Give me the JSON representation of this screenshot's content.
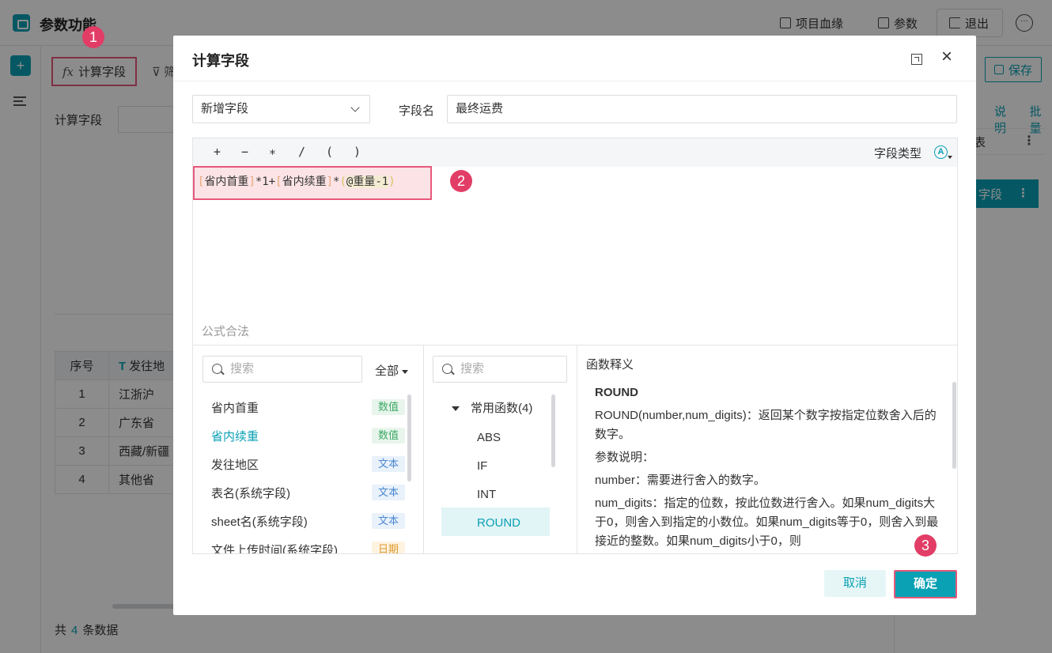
{
  "app": {
    "title": "参数功能",
    "lineage_label": "项目血缘",
    "params_label": "参数",
    "exit_label": "退出"
  },
  "toolbar": {
    "calc_field_label": "计算字段",
    "filter_label": "筛"
  },
  "main": {
    "calc_field_label": "计算字段",
    "table": {
      "headers": [
        "序号",
        "发往地"
      ],
      "rows": [
        [
          "1",
          "江浙沪"
        ],
        [
          "2",
          "广东省"
        ],
        [
          "3",
          "西藏/新疆"
        ],
        [
          "4",
          "其他省"
        ]
      ]
    },
    "footer": {
      "prefix": "共",
      "count": "4",
      "suffix": "条数据"
    }
  },
  "right_panel": {
    "save_label": "保存",
    "explain_link": "说明",
    "batch_link": "批量",
    "row_label": "表",
    "field_label": "字段"
  },
  "badges": [
    "1",
    "2",
    "3"
  ],
  "dialog": {
    "title": "计算字段",
    "mode_select": "新增字段",
    "field_name_label": "字段名",
    "field_name_value": "最终运费",
    "operators": [
      "+",
      "−",
      "∗",
      "/",
      "(",
      ")"
    ],
    "field_type_label": "字段类型",
    "field_type_icon": "A",
    "formula": {
      "part1": "省内首重",
      "op1": "*1+",
      "part2": "省内续重",
      "op2": "*",
      "part3": "@重量-1"
    },
    "hint": "公式合法",
    "fields_pane": {
      "search_placeholder": "搜索",
      "filter_label": "全部",
      "items": [
        {
          "label": "省内首重",
          "type": "数值",
          "kind": "num",
          "active": false
        },
        {
          "label": "省内续重",
          "type": "数值",
          "kind": "num",
          "active": true
        },
        {
          "label": "发往地区",
          "type": "文本",
          "kind": "txt",
          "active": false
        },
        {
          "label": "表名(系统字段)",
          "type": "文本",
          "kind": "txt",
          "active": false
        },
        {
          "label": "sheet名(系统字段)",
          "type": "文本",
          "kind": "txt",
          "active": false
        },
        {
          "label": "文件上传时间(系统字段)",
          "type": "日期",
          "kind": "date",
          "active": false
        }
      ]
    },
    "functions_pane": {
      "search_placeholder": "搜索",
      "category": "常用函数(4)",
      "items": [
        "ABS",
        "IF",
        "INT",
        "ROUND"
      ],
      "selected": "ROUND"
    },
    "description_pane": {
      "title": "函数释义",
      "name": "ROUND",
      "signature": "ROUND(number,num_digits)：返回某个数字按指定位数舍入后的数字。",
      "params_heading": "参数说明：",
      "param1": "number：需要进行舍入的数字。",
      "param2": "num_digits：指定的位数，按此位数进行舍入。如果num_digits大于0，则舍入到指定的小数位。如果num_digits等于0，则舍入到最接近的整数。如果num_digits小于0，则"
    },
    "cancel_label": "取消",
    "ok_label": "确定"
  }
}
